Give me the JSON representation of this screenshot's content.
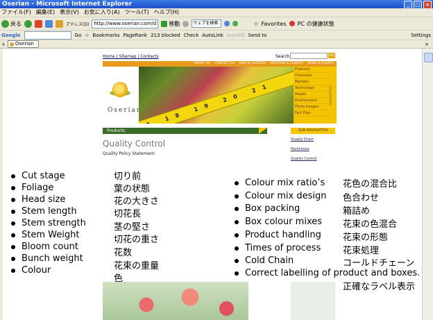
{
  "browser": {
    "title": "Oserian - Microsoft Internet Explorer",
    "menu": [
      "ファイル(F)",
      "編集(E)",
      "表示(V)",
      "お気に入り(A)",
      "ツール(T)",
      "ヘルプ(H)"
    ],
    "back_label": "戻る",
    "address_label": "アドレス(D)",
    "address_value": "http://www.oserian.com/d",
    "go_label": "移動",
    "search_placeholder": "ウェブを検索",
    "favorites_label": "Favorites",
    "pc_security_label": "PC の健康状態",
    "google_label": "Google",
    "go_google_label": "Go",
    "bookmarks_label": "Bookmarks",
    "pagerank_label": "PageRank",
    "blocked_label": "213 blocked",
    "check_label": "Check",
    "autolink_label": "AutoLink",
    "autofill_label": "AutoFill",
    "sendto_label": "Send to",
    "settings_label": "Settings",
    "tab_label": "Oserian"
  },
  "site": {
    "toplinks": "Home | Sitemap | Contacts",
    "search_label": "Search:",
    "go_label": "GO",
    "nav": [
      "ABOUT US",
      "CONTACT US",
      "JOBS & CAREERS",
      "WEATHER & CLIMATE",
      "NEWS & EVENTS"
    ],
    "logo_text": "Oserian",
    "side_menu": [
      "Products",
      "Processes",
      "Markets",
      "Technology",
      "People",
      "Environment",
      "Photo Images",
      "Fact Files"
    ],
    "navigation_label": "NAVIGATION",
    "tape_text": "17 18 19 20 21",
    "products_label": "Products",
    "subnav_label": "SUB NAVIGATION",
    "page_title": "Quality Control",
    "policy_label": "Quality Policy Statement:",
    "sublinks": [
      "Supply Chain",
      "Packhouse",
      "Quality Control"
    ]
  },
  "overlay": {
    "left_en": [
      "Cut stage",
      "Foliage",
      "Head size",
      "Stem length",
      "Stem strength",
      "Stem Weight",
      "Bloom count",
      "Bunch weight",
      "Colour"
    ],
    "left_jp": [
      "切り前",
      "葉の状態",
      "花の大きさ",
      "切花長",
      "茎の堅さ",
      "切花の重さ",
      "花数",
      "花束の重量",
      "色"
    ],
    "right_en": [
      "Colour mix ratio’s",
      "Colour mix design",
      "Box packing",
      "Box colour mixes",
      "Product handling",
      "Times of process",
      "Cold Chain",
      "Correct labelling of product and boxes."
    ],
    "right_jp": [
      "花色の混合比",
      "色合わせ",
      "箱詰め",
      "花束の色混合",
      "花束の形態",
      "花束処理",
      "コールドチェーン",
      "正確なラベル表示"
    ]
  }
}
